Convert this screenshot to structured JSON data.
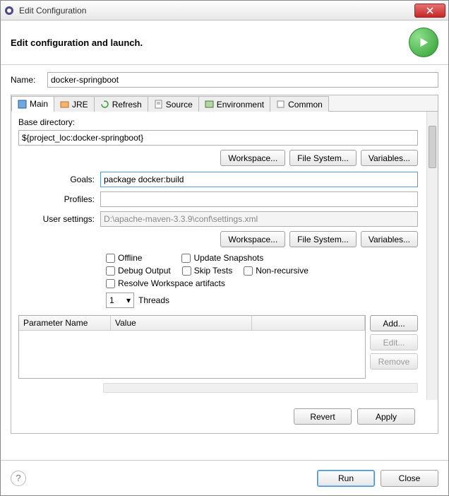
{
  "window": {
    "title": "Edit Configuration"
  },
  "header": {
    "title": "Edit configuration and launch."
  },
  "name": {
    "label": "Name:",
    "value": "docker-springboot"
  },
  "tabs": [
    {
      "label": "Main",
      "active": true
    },
    {
      "label": "JRE"
    },
    {
      "label": "Refresh"
    },
    {
      "label": "Source"
    },
    {
      "label": "Environment"
    },
    {
      "label": "Common"
    }
  ],
  "baseDir": {
    "label": "Base directory:",
    "value": "${project_loc:docker-springboot}",
    "buttons": {
      "workspace": "Workspace...",
      "filesystem": "File System...",
      "variables": "Variables..."
    }
  },
  "goals": {
    "label": "Goals:",
    "value": "package docker:build"
  },
  "profiles": {
    "label": "Profiles:",
    "value": ""
  },
  "userSettings": {
    "label": "User settings:",
    "value": "D:\\apache-maven-3.3.9\\conf\\settings.xml",
    "buttons": {
      "workspace": "Workspace...",
      "filesystem": "File System...",
      "variables": "Variables..."
    }
  },
  "checks": {
    "offline": "Offline",
    "updateSnapshots": "Update Snapshots",
    "debugOutput": "Debug Output",
    "skipTests": "Skip Tests",
    "nonRecursive": "Non-recursive",
    "resolveWs": "Resolve Workspace artifacts"
  },
  "threads": {
    "value": "1",
    "label": "Threads"
  },
  "paramTable": {
    "colName": "Parameter Name",
    "colValue": "Value",
    "buttons": {
      "add": "Add...",
      "edit": "Edit...",
      "remove": "Remove"
    }
  },
  "footerTabBtns": {
    "revert": "Revert",
    "apply": "Apply"
  },
  "dialogBtns": {
    "run": "Run",
    "close": "Close"
  }
}
